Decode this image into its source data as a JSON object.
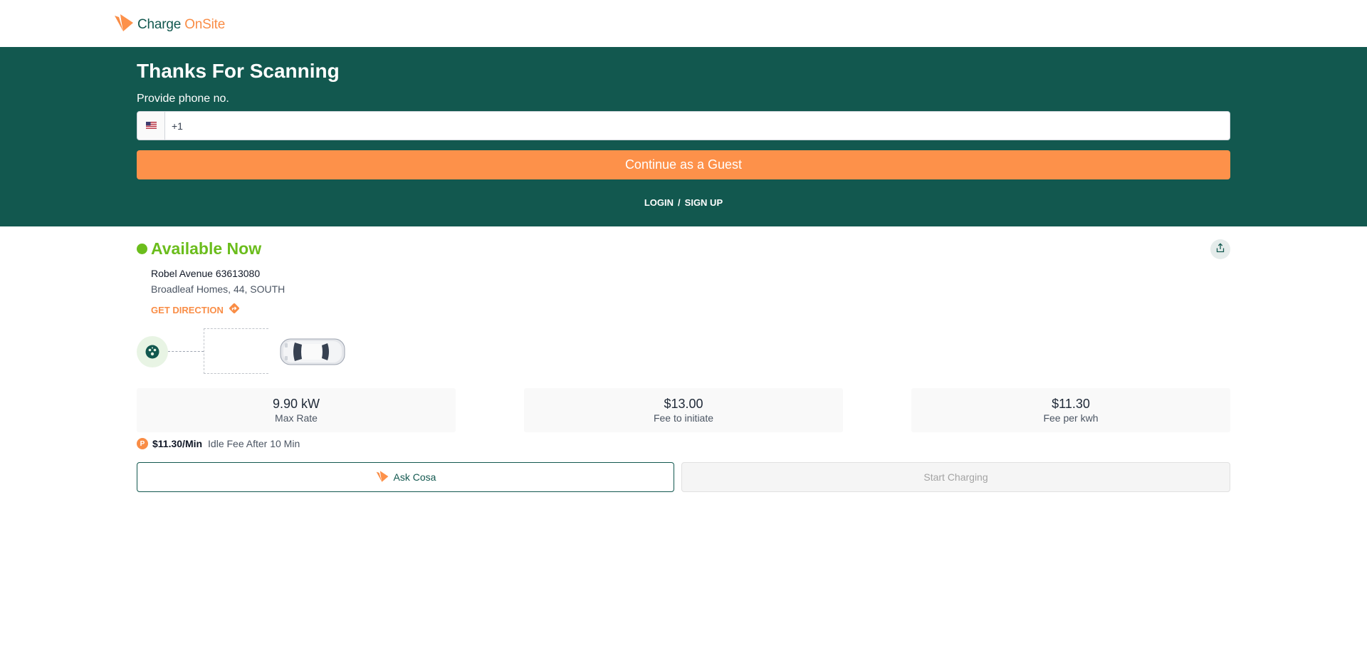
{
  "header": {
    "logo_main": "Charge",
    "logo_accent": "OnSite"
  },
  "hero": {
    "title": "Thanks For Scanning",
    "phone_label": "Provide phone no.",
    "phone_value": "+1",
    "country_flag": "us-flag-icon",
    "guest_button": "Continue as a Guest",
    "login_label": "LOGIN",
    "separator": "/",
    "signup_label": "SIGN UP"
  },
  "station": {
    "status": "Available Now",
    "status_color": "#6bbd1c",
    "name": "Robel Avenue 63613080",
    "address": "Broadleaf Homes, 44, SOUTH",
    "direction_label": "GET DIRECTION"
  },
  "stats": [
    {
      "value": "9.90 kW",
      "label": "Max Rate"
    },
    {
      "value": "$13.00",
      "label": "Fee to initiate"
    },
    {
      "value": "$11.30",
      "label": "Fee per kwh"
    }
  ],
  "idle": {
    "badge": "P",
    "price": "$11.30/Min",
    "description": "Idle Fee After 10 Min"
  },
  "actions": {
    "ask_label": "Ask Cosa",
    "start_label": "Start Charging"
  },
  "colors": {
    "brand_dark": "#12584f",
    "brand_orange": "#fd914a"
  }
}
